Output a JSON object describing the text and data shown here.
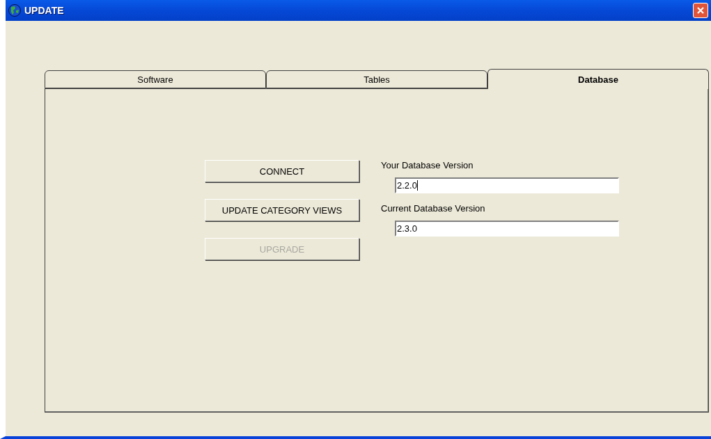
{
  "window": {
    "title": "UPDATE"
  },
  "tabs": [
    {
      "label": "Software",
      "selected": false
    },
    {
      "label": "Tables",
      "selected": false
    },
    {
      "label": "Database",
      "selected": true
    }
  ],
  "buttons": [
    {
      "label": "CONNECT",
      "disabled": false
    },
    {
      "label": "UPDATE CATEGORY VIEWS",
      "disabled": false
    },
    {
      "label": "UPGRADE",
      "disabled": true
    }
  ],
  "fields": [
    {
      "label": "Your Database Version",
      "value": "2.2.0",
      "focused": true
    },
    {
      "label": "Current Database Version",
      "value": "2.3.0",
      "focused": false
    }
  ]
}
